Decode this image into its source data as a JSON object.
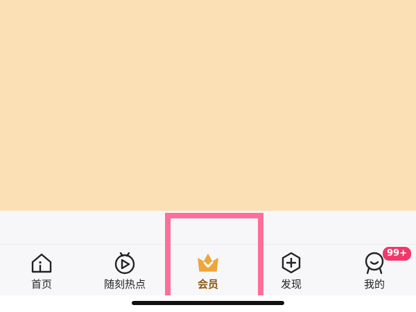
{
  "tabbar": {
    "tabs": [
      {
        "label": "首页",
        "icon": "home-icon"
      },
      {
        "label": "随刻热点",
        "icon": "tv-play-icon"
      },
      {
        "label": "会员",
        "icon": "vip-crown-icon",
        "active": true
      },
      {
        "label": "发现",
        "icon": "add-hexagon-icon"
      },
      {
        "label": "我的",
        "icon": "profile-icon"
      }
    ],
    "badge": "99+"
  },
  "colors": {
    "top_area": "#fbe0b6",
    "tabbar_bg": "#f7f7fa",
    "active_label": "#8a5a12",
    "vip_gold": "#efa53a",
    "badge_bg": "#f0396a",
    "highlight_border": "#fd6f98"
  }
}
